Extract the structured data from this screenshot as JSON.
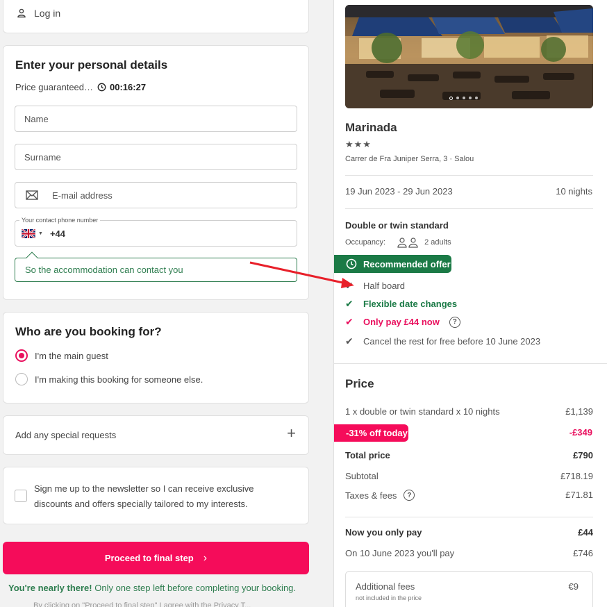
{
  "login": {
    "label": "Log in"
  },
  "details": {
    "title": "Enter your personal details",
    "price_guaranteed": "Price guaranteed…",
    "timer": "00:16:27",
    "name_placeholder": "Name",
    "surname_placeholder": "Surname",
    "email_placeholder": "E-mail address",
    "phone_label": "Your contact phone number",
    "phone_code": "+44",
    "hint": "So the accommodation can contact you"
  },
  "booking_for": {
    "title": "Who are you booking for?",
    "options": [
      {
        "label": "I'm the main guest",
        "selected": true
      },
      {
        "label": "I'm making this booking for someone else.",
        "selected": false
      }
    ]
  },
  "special_requests": {
    "label": "Add any special requests"
  },
  "newsletter": {
    "label": "Sign me up to the newsletter so I can receive exclusive discounts and offers specially tailored to my interests."
  },
  "proceed": {
    "label": "Proceed to final step"
  },
  "nearly": {
    "bold": "You're nearly there!",
    "rest": " Only one step left before completing your booking."
  },
  "cutoff_text": "By clicking on \"Proceed to final step\" I agree with the Privacy T...",
  "hotel": {
    "name": "Marinada",
    "stars": "★★★",
    "address": "Carrer de Fra Juniper Serra, 3 · Salou",
    "dates": "19 Jun 2023 - 29 Jun 2023",
    "nights": "10 nights",
    "room": "Double or twin standard",
    "occupancy_label": "Occupancy:",
    "occupancy_value": "2 adults"
  },
  "offer": {
    "badge": "Recommended offer",
    "features": [
      {
        "label": "Half board"
      },
      {
        "label": "Flexible date changes"
      },
      {
        "label": "Only pay £44 now"
      },
      {
        "label": "Cancel the rest for free before 10 June 2023"
      }
    ]
  },
  "price": {
    "title": "Price",
    "line_label": "1 x double or twin standard x 10 nights",
    "line_value": "£1,139",
    "discount_label": "-31% off today",
    "discount_value": "-£349",
    "total_label": "Total price",
    "total_value": "£790",
    "subtotal_label": "Subtotal",
    "subtotal_value": "£718.19",
    "taxes_label": "Taxes & fees",
    "taxes_value": "£71.81",
    "now_label": "Now you only pay",
    "now_value": "£44",
    "later_label": "On 10 June 2023 you'll pay",
    "later_value": "£746",
    "fees_label": "Additional fees",
    "fees_sub": "not included in the price",
    "fees_value": "€9"
  },
  "colors": {
    "accent": "#f50c5a",
    "green": "#1b7a46",
    "arrow": "#e8202a"
  }
}
